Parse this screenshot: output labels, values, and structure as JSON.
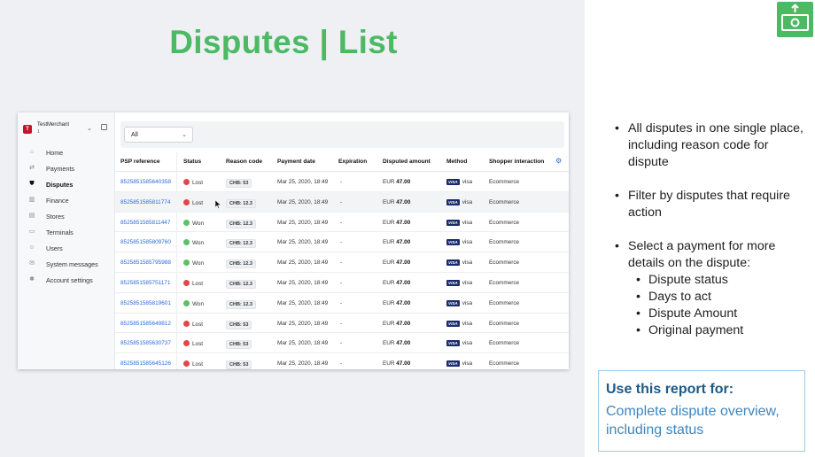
{
  "slide": {
    "title": "Disputes | List",
    "bullets": [
      {
        "text": "All disputes in one single place, including reason code for dispute"
      },
      {
        "text": "Filter by disputes that require action"
      },
      {
        "text": "Select a payment for more details on the dispute:",
        "subitems": [
          "Dispute status",
          "Days to act",
          "Dispute Amount",
          "Original payment"
        ]
      }
    ],
    "use_box": {
      "heading": "Use this report for:",
      "body": "Complete dispute overview, including status"
    },
    "accent_color": "#4cb963",
    "corner_icon": "money-upload-icon"
  },
  "app": {
    "merchant": {
      "badge": "T",
      "name": "TestMerchant",
      "sub": "1"
    },
    "nav": [
      {
        "label": "Home",
        "icon": "home-icon",
        "active": false
      },
      {
        "label": "Payments",
        "icon": "payments-icon",
        "active": false
      },
      {
        "label": "Disputes",
        "icon": "shield-icon",
        "active": true
      },
      {
        "label": "Finance",
        "icon": "bar-chart-icon",
        "active": false
      },
      {
        "label": "Stores",
        "icon": "store-icon",
        "active": false
      },
      {
        "label": "Terminals",
        "icon": "terminal-icon",
        "active": false
      },
      {
        "label": "Users",
        "icon": "users-icon",
        "active": false
      },
      {
        "label": "System messages",
        "icon": "message-icon",
        "active": false
      },
      {
        "label": "Account settings",
        "icon": "gear-icon",
        "active": false
      }
    ],
    "filter": {
      "selected": "All"
    },
    "columns": [
      "PSP reference",
      "Status",
      "Reason code",
      "Payment date",
      "Expiration",
      "Disputed amount",
      "Method",
      "Shopper interaction"
    ],
    "rows": [
      {
        "ref": "8525851585640358",
        "status": "Lost",
        "code": "CHB: 53",
        "date": "Mar 25, 2020, 18:49",
        "exp": "-",
        "cur": "EUR",
        "amount": "47.00",
        "method": "visa",
        "interaction": "Ecommerce"
      },
      {
        "ref": "8525851585811774",
        "status": "Lost",
        "code": "CHB: 12.3",
        "date": "Mar 25, 2020, 18:49",
        "exp": "-",
        "cur": "EUR",
        "amount": "47.00",
        "method": "visa",
        "interaction": "Ecommerce"
      },
      {
        "ref": "8525851585811447",
        "status": "Won",
        "code": "CHB: 12.3",
        "date": "Mar 25, 2020, 18:49",
        "exp": "-",
        "cur": "EUR",
        "amount": "47.00",
        "method": "visa",
        "interaction": "Ecommerce"
      },
      {
        "ref": "8525851585809760",
        "status": "Won",
        "code": "CHB: 12.3",
        "date": "Mar 25, 2020, 18:49",
        "exp": "-",
        "cur": "EUR",
        "amount": "47.00",
        "method": "visa",
        "interaction": "Ecommerce"
      },
      {
        "ref": "8525851585795988",
        "status": "Won",
        "code": "CHB: 12.3",
        "date": "Mar 25, 2020, 18:49",
        "exp": "-",
        "cur": "EUR",
        "amount": "47.00",
        "method": "visa",
        "interaction": "Ecommerce"
      },
      {
        "ref": "8525851585751171",
        "status": "Lost",
        "code": "CHB: 12.3",
        "date": "Mar 25, 2020, 18:49",
        "exp": "-",
        "cur": "EUR",
        "amount": "47.00",
        "method": "visa",
        "interaction": "Ecommerce"
      },
      {
        "ref": "8525851585819601",
        "status": "Won",
        "code": "CHB: 12.3",
        "date": "Mar 25, 2020, 18:49",
        "exp": "-",
        "cur": "EUR",
        "amount": "47.00",
        "method": "visa",
        "interaction": "Ecommerce"
      },
      {
        "ref": "8525851585649812",
        "status": "Lost",
        "code": "CHB: 53",
        "date": "Mar 25, 2020, 18:49",
        "exp": "-",
        "cur": "EUR",
        "amount": "47.00",
        "method": "visa",
        "interaction": "Ecommerce"
      },
      {
        "ref": "8525851585630737",
        "status": "Lost",
        "code": "CHB: 53",
        "date": "Mar 25, 2020, 18:49",
        "exp": "-",
        "cur": "EUR",
        "amount": "47.00",
        "method": "visa",
        "interaction": "Ecommerce"
      },
      {
        "ref": "8525851585645126",
        "status": "Lost",
        "code": "CHB: 53",
        "date": "Mar 25, 2020, 18:49",
        "exp": "-",
        "cur": "EUR",
        "amount": "47.00",
        "method": "visa",
        "interaction": "Ecommerce"
      }
    ],
    "status_colors": {
      "Lost": "#e0474c",
      "Won": "#5cbf6a"
    },
    "highlight_row": 1
  }
}
